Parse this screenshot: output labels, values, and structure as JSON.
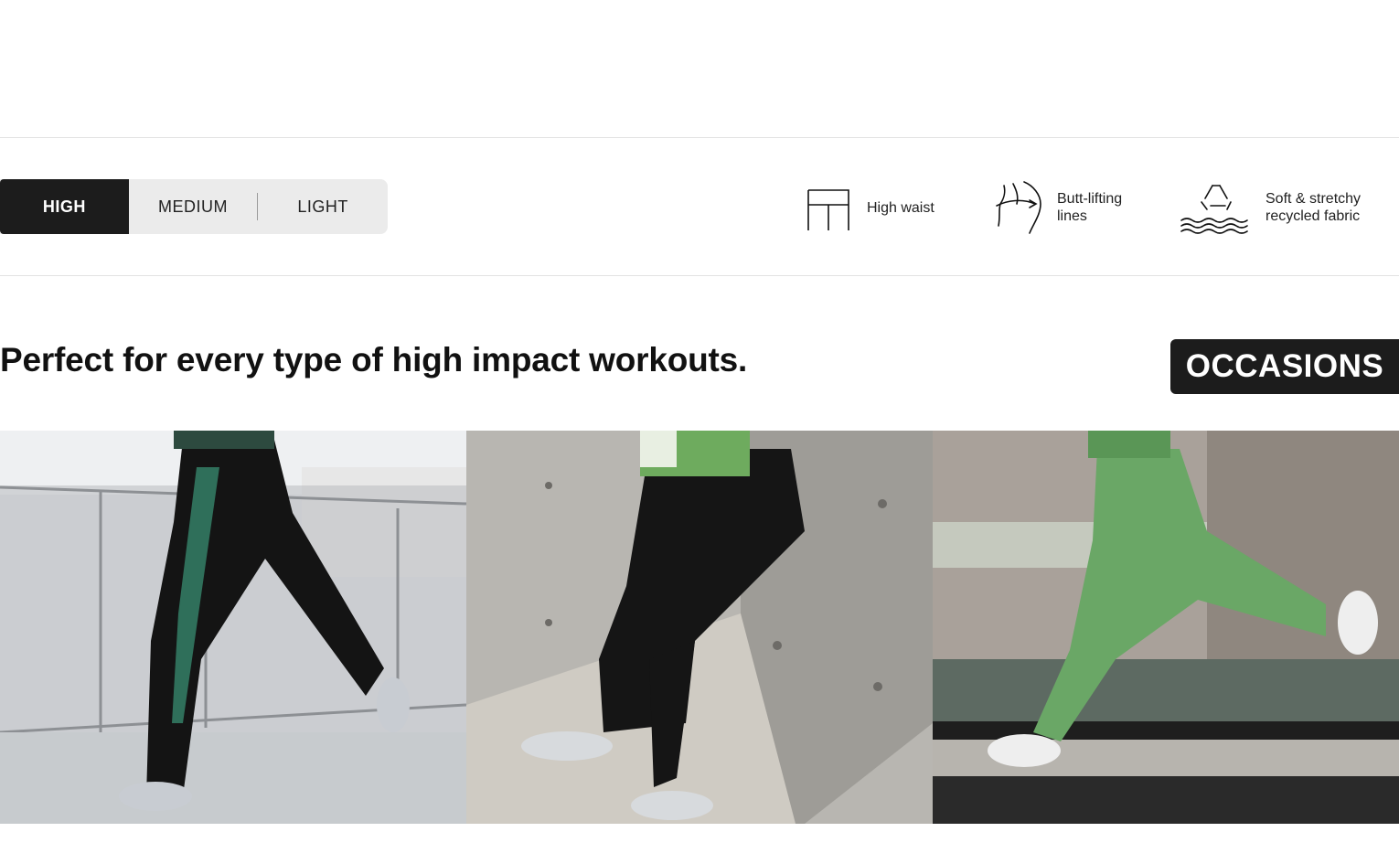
{
  "impact_levels": {
    "options": [
      "HIGH",
      "MEDIUM",
      "LIGHT"
    ],
    "selected": "HIGH"
  },
  "features": [
    {
      "icon": "high-waist-icon",
      "lines": [
        "High waist"
      ]
    },
    {
      "icon": "butt-lift-icon",
      "lines": [
        "Butt-lifting",
        "lines"
      ]
    },
    {
      "icon": "recycle-icon",
      "lines": [
        "Soft & stretchy",
        "recycled fabric"
      ]
    }
  ],
  "section": {
    "headline": "Perfect for every type of high impact workouts.",
    "badge": "OCCASIONS"
  },
  "photos": [
    {
      "name": "photo-running-patterned-leggings"
    },
    {
      "name": "photo-leaning-wall-black-leggings"
    },
    {
      "name": "photo-running-green-leggings"
    }
  ],
  "colors": {
    "accent_dark": "#1c1c1c",
    "segment_bg": "#ebebeb",
    "divider": "#e2e2e2",
    "legging_green": "#6aa766"
  }
}
